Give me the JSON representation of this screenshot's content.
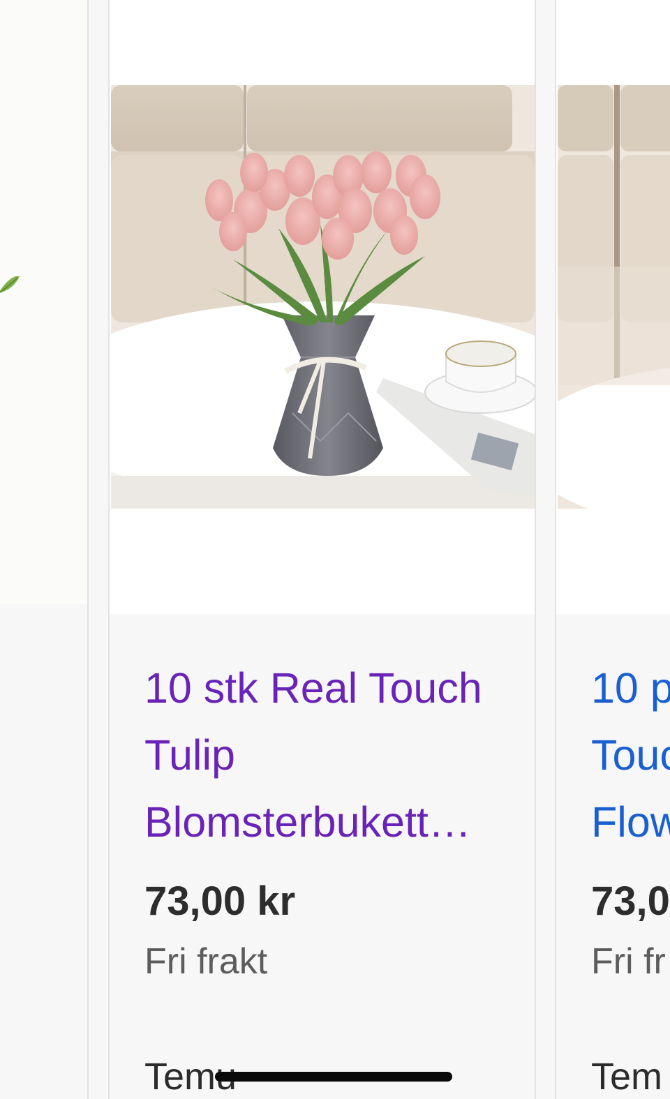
{
  "products": {
    "main": {
      "title_lines": [
        "10 stk Real Touch",
        "Tulip",
        "Blomsterbukett…"
      ],
      "price": "73,00 kr",
      "shipping": "Fri frakt",
      "store": "Temu",
      "link_color": "#6a23b7"
    },
    "next": {
      "title_lines": [
        "10 p",
        "Touc",
        "Flow"
      ],
      "price": "73,0",
      "shipping": "Fri fr",
      "store": "Tem",
      "link_color": "#1a5fd1"
    }
  },
  "images": {
    "main": "pink-tulip-bouquet-photo",
    "next": "tulip-photo-partial",
    "prev": "green-leaf-photo-partial"
  }
}
